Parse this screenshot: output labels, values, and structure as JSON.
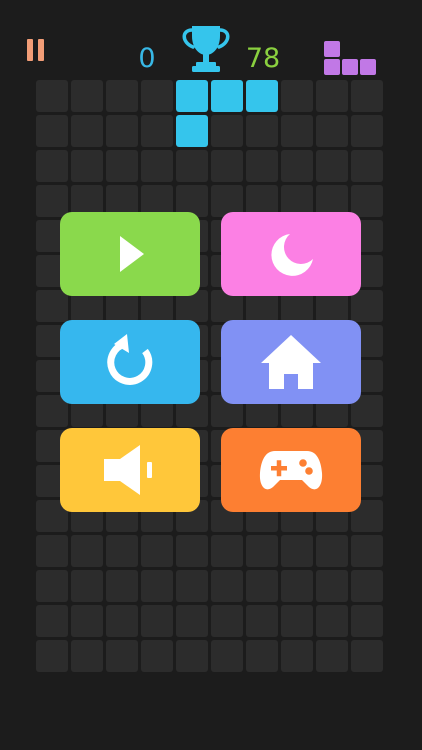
{
  "hud": {
    "score": "0",
    "best_score": "78"
  },
  "colors": {
    "background": "#1c1c1c",
    "empty_cell": "#2c2c2c",
    "active_piece": "#35c5ec",
    "score": "#38b8e6",
    "best_score": "#8ad03f",
    "trophy": "#35c5ec",
    "pause": "#f29d77",
    "next_piece": "#c178e6"
  },
  "board": {
    "columns": 10,
    "rows": 17,
    "active_piece_cells": [
      [
        4,
        0
      ],
      [
        5,
        0
      ],
      [
        6,
        0
      ],
      [
        4,
        1
      ]
    ]
  },
  "next_piece": {
    "shape": "J",
    "cells": [
      [
        0,
        0
      ],
      [
        0,
        1
      ],
      [
        1,
        1
      ],
      [
        2,
        1
      ]
    ]
  },
  "menu": {
    "buttons": [
      {
        "id": "play",
        "icon": "play-icon",
        "color": "#8ad94c"
      },
      {
        "id": "night-mode",
        "icon": "crescent-moon-icon",
        "color": "#fc80e4"
      },
      {
        "id": "restart",
        "icon": "restart-icon",
        "color": "#36b7ee"
      },
      {
        "id": "home",
        "icon": "home-icon",
        "color": "#8191f4"
      },
      {
        "id": "sound",
        "icon": "speaker-icon",
        "color": "#ffc73a"
      },
      {
        "id": "more-games",
        "icon": "gamepad-icon",
        "color": "#fd7f32"
      }
    ]
  }
}
